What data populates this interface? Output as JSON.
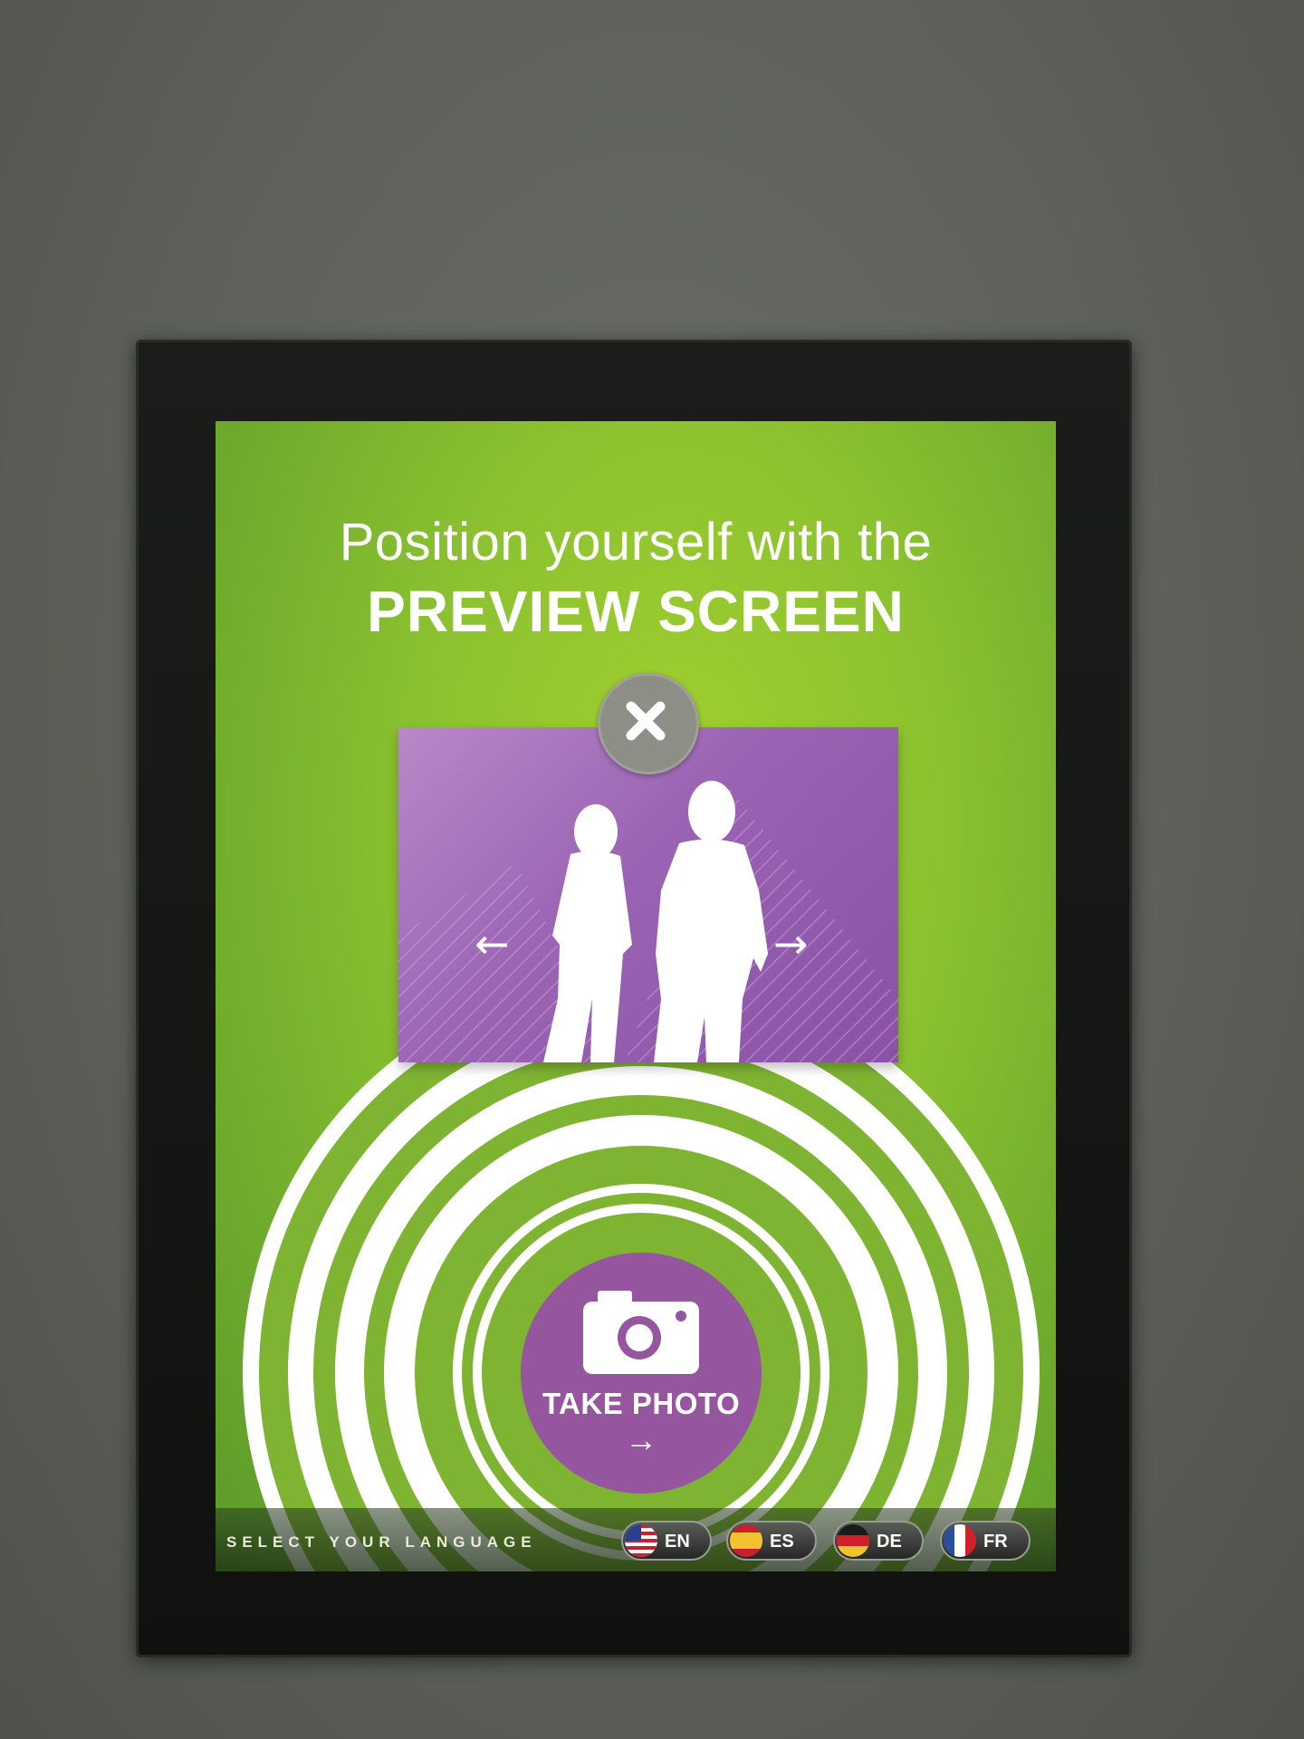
{
  "screen": {
    "headline_line1": "Position yourself with the",
    "headline_line2": "PREVIEW SCREEN"
  },
  "preview": {
    "close_icon": "close-icon",
    "left_arrow": "←",
    "right_arrow": "→"
  },
  "take_photo": {
    "icon": "camera-icon",
    "label": "TAKE PHOTO",
    "arrow": "→"
  },
  "language_bar": {
    "prompt": "SELECT YOUR LANGUAGE",
    "languages": [
      {
        "code": "EN",
        "flag": "us-flag-icon",
        "selected": true
      },
      {
        "code": "ES",
        "flag": "spain-flag-icon",
        "selected": false
      },
      {
        "code": "DE",
        "flag": "germany-flag-icon",
        "selected": false
      },
      {
        "code": "FR",
        "flag": "france-flag-icon",
        "selected": false
      }
    ]
  },
  "colors": {
    "background_green": "#8cc230",
    "accent_purple": "#95559f",
    "ring_white": "#ffffff"
  }
}
